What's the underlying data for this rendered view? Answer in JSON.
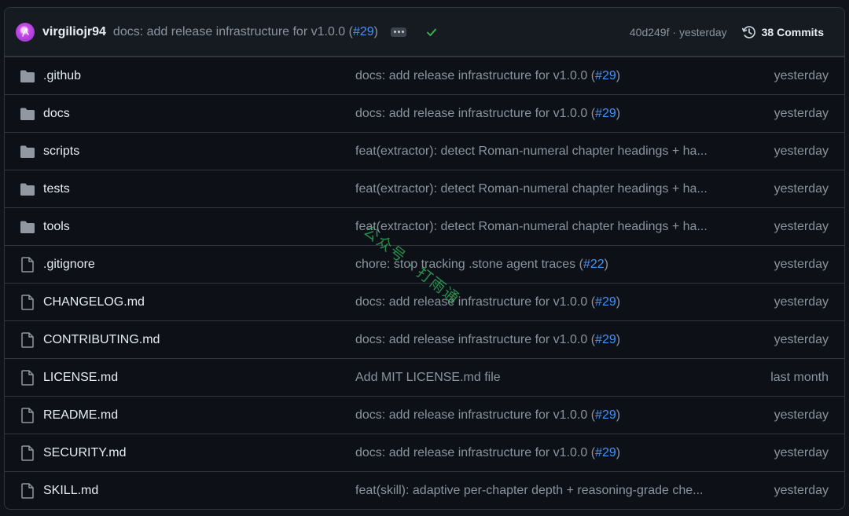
{
  "latest_commit": {
    "author": "virgiliojr94",
    "message": "docs: add release infrastructure for v1.0.0 (",
    "pr": "#29",
    "message_end": ")",
    "sha": "40d249f",
    "separator": " · ",
    "time": "yesterday",
    "commits_label": "38 Commits"
  },
  "files": [
    {
      "type": "dir",
      "name": ".github",
      "message": "docs: add release infrastructure for v1.0.0 (",
      "pr": "#29",
      "message_end": ")",
      "date": "yesterday"
    },
    {
      "type": "dir",
      "name": "docs",
      "message": "docs: add release infrastructure for v1.0.0 (",
      "pr": "#29",
      "message_end": ")",
      "date": "yesterday"
    },
    {
      "type": "dir",
      "name": "scripts",
      "message": "feat(extractor): detect Roman-numeral chapter headings + ha...",
      "pr": "",
      "message_end": "",
      "date": "yesterday"
    },
    {
      "type": "dir",
      "name": "tests",
      "message": "feat(extractor): detect Roman-numeral chapter headings + ha...",
      "pr": "",
      "message_end": "",
      "date": "yesterday"
    },
    {
      "type": "dir",
      "name": "tools",
      "message": "feat(extractor): detect Roman-numeral chapter headings + ha...",
      "pr": "",
      "message_end": "",
      "date": "yesterday"
    },
    {
      "type": "file",
      "name": ".gitignore",
      "message": "chore: stop tracking .stone agent traces (",
      "pr": "#22",
      "message_end": ")",
      "date": "yesterday"
    },
    {
      "type": "file",
      "name": "CHANGELOG.md",
      "message": "docs: add release infrastructure for v1.0.0 (",
      "pr": "#29",
      "message_end": ")",
      "date": "yesterday"
    },
    {
      "type": "file",
      "name": "CONTRIBUTING.md",
      "message": "docs: add release infrastructure for v1.0.0 (",
      "pr": "#29",
      "message_end": ")",
      "date": "yesterday"
    },
    {
      "type": "file",
      "name": "LICENSE.md",
      "message": "Add MIT LICENSE.md file",
      "pr": "",
      "message_end": "",
      "date": "last month"
    },
    {
      "type": "file",
      "name": "README.md",
      "message": "docs: add release infrastructure for v1.0.0 (",
      "pr": "#29",
      "message_end": ")",
      "date": "yesterday"
    },
    {
      "type": "file",
      "name": "SECURITY.md",
      "message": "docs: add release infrastructure for v1.0.0 (",
      "pr": "#29",
      "message_end": ")",
      "date": "yesterday"
    },
    {
      "type": "file",
      "name": "SKILL.md",
      "message": "feat(skill): adaptive per-chapter depth + reasoning-grade che...",
      "pr": "",
      "message_end": "",
      "date": "yesterday"
    }
  ],
  "watermark": "公众号 · 打雨通",
  "colors": {
    "background": "#0d1117",
    "header": "#161b22",
    "border": "#30363d",
    "text": "#e6edf3",
    "muted": "#8b949e",
    "link": "#4493f8",
    "check": "#3fb950",
    "icon": "#9198a1"
  },
  "icons": {
    "dir": "folder-icon",
    "file": "file-icon",
    "history": "history-icon",
    "status": "check-icon"
  }
}
